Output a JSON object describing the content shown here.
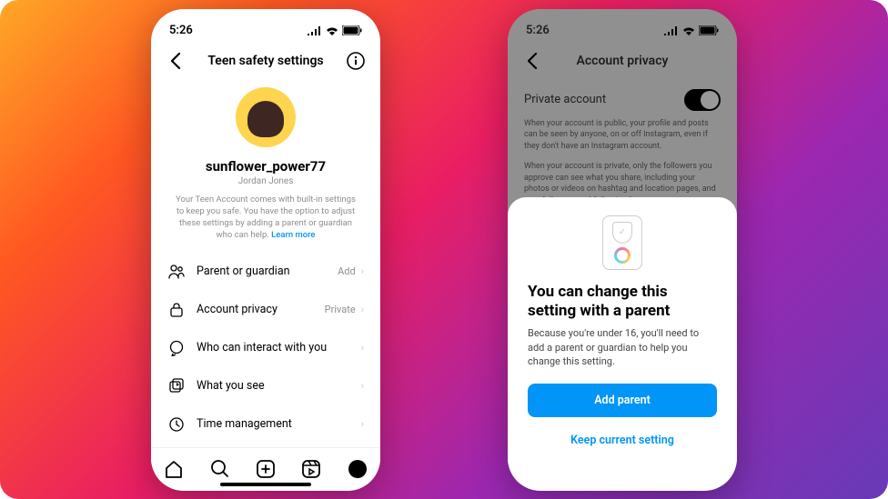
{
  "status": {
    "time": "5:26"
  },
  "left": {
    "header_title": "Teen safety settings",
    "username": "sunflower_power77",
    "display_name": "Jordan Jones",
    "description": "Your Teen Account comes with built-in settings to keep you safe. You have the option to adjust these settings by adding a parent or guardian who can help. ",
    "learn_more": "Learn more",
    "settings": [
      {
        "label": "Parent or guardian",
        "value": "Add"
      },
      {
        "label": "Account privacy",
        "value": "Private"
      },
      {
        "label": "Who can interact with you",
        "value": ""
      },
      {
        "label": "What you see",
        "value": ""
      },
      {
        "label": "Time management",
        "value": ""
      }
    ]
  },
  "right": {
    "header_title": "Account privacy",
    "toggle_label": "Private account",
    "desc1": "When your account is public, your profile and posts can be seen by anyone, on or off Instagram, even if they don't have an Instagram account.",
    "desc2": "When your account is private, only the followers you approve can see what you share, including your photos or videos on hashtag and location pages, and your followers and following lists.",
    "sheet": {
      "title": "You can change this setting with a parent",
      "desc": "Because you're under 16, you'll need to add a parent or guardian to help you change this setting.",
      "primary": "Add parent",
      "secondary": "Keep current setting"
    }
  }
}
